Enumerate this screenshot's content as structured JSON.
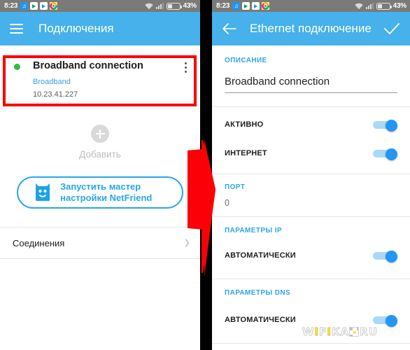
{
  "meta": {
    "arrow_color": "#fb0007",
    "accent_color": "#46b1ea",
    "toggle_on_color": "#2196f3",
    "highlight_border_color": "#fb0007",
    "status_dot_color": "#2fbf36"
  },
  "status_bar": {
    "clock": "8:23",
    "battery_percent": "43%",
    "icons": [
      "music-app-icon",
      "play-store-icon",
      "play-movies-icon",
      "chrome-icon",
      "wifi-icon",
      "signal-icon",
      "battery-icon"
    ]
  },
  "left_screen": {
    "appbar": {
      "menu_icon": "hamburger-icon",
      "title": "Подключения"
    },
    "connection": {
      "name": "Broadband connection",
      "type": "Broadband",
      "ip": "10.23.41.227",
      "status": "active",
      "menu_icon": "kebab-menu-icon",
      "highlighted": true
    },
    "add": {
      "icon": "plus-circle-icon",
      "label": "Добавить"
    },
    "netfriend_button": {
      "icon": "netfriend-robot-icon",
      "line1": "Запустить мастер",
      "line2": "настройки NetFriend"
    },
    "connections_row": {
      "label": "Соединения",
      "chevron": "chevron-right-icon"
    }
  },
  "right_screen": {
    "appbar": {
      "back_icon": "back-arrow-icon",
      "title": "Ethernet подключение",
      "confirm_icon": "checkmark-icon"
    },
    "description": {
      "label": "ОПИСАНИЕ",
      "value": "Broadband connection"
    },
    "toggles": [
      {
        "label": "АКТИВНО",
        "on": true
      },
      {
        "label": "ИНТЕРНЕТ",
        "on": true
      }
    ],
    "port": {
      "label": "ПОРТ",
      "value": "0"
    },
    "ip_params": {
      "label": "ПАРАМЕТРЫ IP",
      "toggle_label": "АВТОМАТИЧЕСКИ",
      "on": true
    },
    "dns_params": {
      "label": "ПАРАМЕТРЫ DNS",
      "toggle_label": "АВТОМАТИЧЕСКИ",
      "on": true
    }
  },
  "watermark": {
    "part1": "W",
    "part2": "I",
    "part3": "F",
    "part4": "I",
    "part5": "K",
    "part6": "A",
    "part7": "R",
    "part8": "U"
  }
}
